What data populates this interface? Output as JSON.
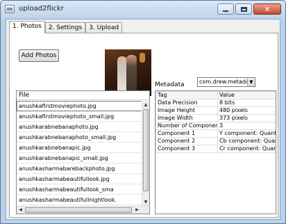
{
  "window": {
    "title": "upload2flickr"
  },
  "tabs": [
    {
      "label": "1. Photos"
    },
    {
      "label": "2. Settings"
    },
    {
      "label": "3. Upload"
    }
  ],
  "photos": {
    "add_button_label": "Add Photos",
    "metadata_label": "Metadata",
    "metadata_select_value": "com.drew.metadata.j",
    "file_header": "File",
    "files": [
      "anushkafirstmoviephoto.jpg",
      "anushkafirstmoviephoto_small.jpg",
      "anushkarabnebanaphoto.jpg",
      "anushkarabnebanaphoto_small.jpg",
      "anushkarabnebanapic.jpg",
      "anushkarabnebanapic_small.jpg",
      "anushkasharmabarebackphoto.jpg",
      "anushkasharmabeautifullook.jpg",
      "anushkasharmabeautifullook_sma",
      "anushkasharmabeautifullnightlook."
    ],
    "metadata_columns": [
      "Tag",
      "Value"
    ],
    "metadata_rows": [
      [
        "Data Precision",
        "8 bits"
      ],
      [
        "Image Height",
        "480 pixels"
      ],
      [
        "Image Width",
        "373 pixels"
      ],
      [
        "Number of Components",
        "3"
      ],
      [
        "Component 1",
        "Y component: Quantiz"
      ],
      [
        "Component 2",
        "Cb component: Quanti"
      ],
      [
        "Component 3",
        "Cr component: Quanti"
      ]
    ]
  }
}
